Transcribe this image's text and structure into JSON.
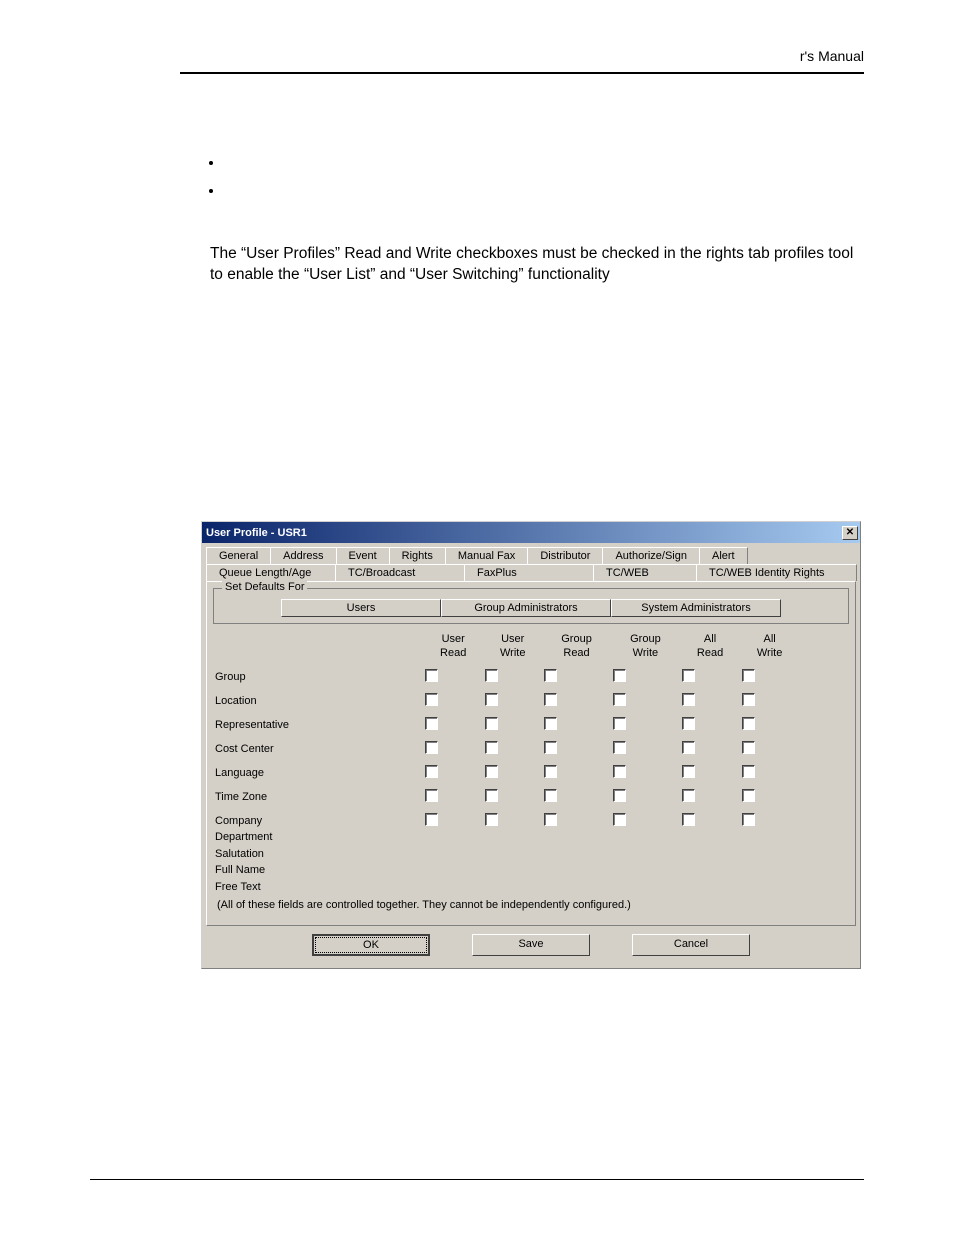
{
  "page": {
    "header_text": "r's Manual",
    "note": "The “User Profiles” Read and Write checkboxes must be checked in the rights tab profiles tool to enable the “User List” and “User Switching” functionality"
  },
  "dialog": {
    "title": "User Profile - USR1",
    "tabs_row1": [
      "General",
      "Address",
      "Event",
      "Rights",
      "Manual Fax",
      "Distributor",
      "Authorize/Sign",
      "Alert"
    ],
    "tabs_row2": [
      "Queue Length/Age",
      "TC/Broadcast",
      "FaxPlus",
      "TC/WEB",
      "TC/WEB Identity Rights"
    ],
    "group_label": "Set Defaults For",
    "defaults_buttons": [
      "Users",
      "Group Administrators",
      "System Administrators"
    ],
    "col_heads": [
      {
        "l1": "User",
        "l2": "Read"
      },
      {
        "l1": "User",
        "l2": "Write"
      },
      {
        "l1": "Group",
        "l2": "Read"
      },
      {
        "l1": "Group",
        "l2": "Write"
      },
      {
        "l1": "All",
        "l2": "Read"
      },
      {
        "l1": "All",
        "l2": "Write"
      }
    ],
    "rows": [
      "Group",
      "Location",
      "Representative",
      "Cost Center",
      "Language",
      "Time Zone"
    ],
    "multi_labels": [
      "Company",
      "Department",
      "Salutation",
      "Full Name",
      "Free Text"
    ],
    "note_small": "(All of these fields are controlled together. They cannot be independently configured.)",
    "buttons": {
      "ok": "OK",
      "save": "Save",
      "cancel": "Cancel"
    }
  }
}
